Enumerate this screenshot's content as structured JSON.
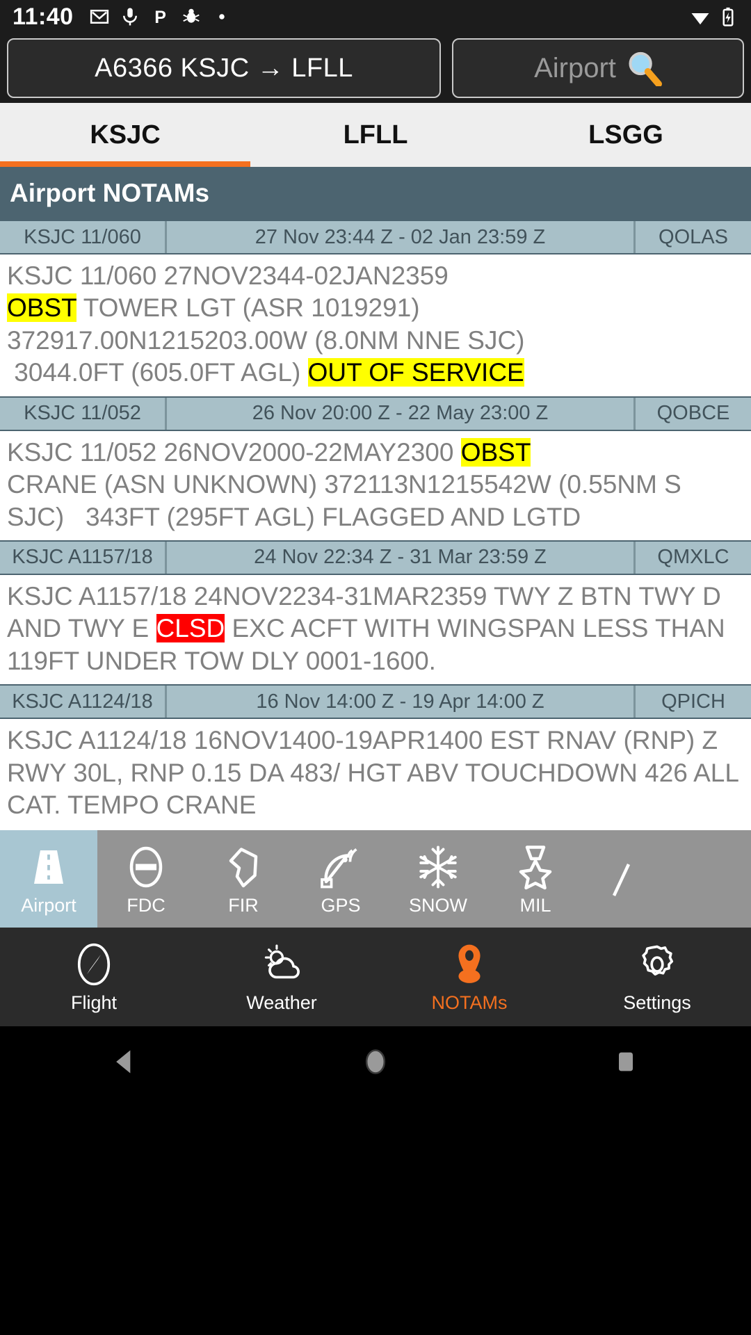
{
  "status_bar": {
    "time": "11:40",
    "icons": [
      "gmail-icon",
      "microphone-icon",
      "parking-icon",
      "bug-icon",
      "dot-icon"
    ],
    "right_icons": [
      "wifi-icon",
      "battery-charging-icon"
    ]
  },
  "topbar": {
    "route_label": "A6366 KSJC → LFLL",
    "search_placeholder": "Airport",
    "search_icon": "magnifier-icon"
  },
  "tabs": [
    {
      "label": "KSJC",
      "active": true
    },
    {
      "label": "LFLL",
      "active": false
    },
    {
      "label": "LSGG",
      "active": false
    }
  ],
  "section": {
    "title": "Airport NOTAMs"
  },
  "notams": [
    {
      "id": "KSJC 11/060",
      "period": "27 Nov 23:44 Z - 02 Jan 23:59 Z",
      "code": "QOLAS",
      "segments": [
        {
          "text": "KSJC 11/060 27NOV2344-02JAN2359\n",
          "highlight": "none"
        },
        {
          "text": "OBST",
          "highlight": "yellow"
        },
        {
          "text": " TOWER LGT (ASR 1019291)\n372917.00N1215203.00W (8.0NM NNE SJC)\n 3044.0FT (605.0FT AGL) ",
          "highlight": "none"
        },
        {
          "text": "OUT OF SERVICE",
          "highlight": "yellow"
        }
      ]
    },
    {
      "id": "KSJC 11/052",
      "period": "26 Nov 20:00 Z - 22 May 23:00 Z",
      "code": "QOBCE",
      "segments": [
        {
          "text": "KSJC 11/052 26NOV2000-22MAY2300 ",
          "highlight": "none"
        },
        {
          "text": "OBST",
          "highlight": "yellow"
        },
        {
          "text": "\nCRANE (ASN UNKNOWN) 372113N1215542W (0.55NM S SJC)   343FT (295FT AGL) FLAGGED AND LGTD",
          "highlight": "none"
        }
      ]
    },
    {
      "id": "KSJC A1157/18",
      "period": "24 Nov 22:34 Z - 31 Mar 23:59 Z",
      "code": "QMXLC",
      "segments": [
        {
          "text": "KSJC A1157/18 24NOV2234-31MAR2359 TWY Z BTN TWY D AND TWY E ",
          "highlight": "none"
        },
        {
          "text": "CLSD",
          "highlight": "red"
        },
        {
          "text": " EXC ACFT WITH WINGSPAN LESS THAN 119FT UNDER TOW DLY 0001-1600.",
          "highlight": "none"
        }
      ]
    },
    {
      "id": "KSJC A1124/18",
      "period": "16 Nov 14:00 Z - 19 Apr 14:00 Z",
      "code": "QPICH",
      "segments": [
        {
          "text": "KSJC A1124/18 16NOV1400-19APR1400 EST RNAV (RNP) Z RWY 30L, RNP 0.15 DA 483/ HGT ABV TOUCHDOWN 426 ALL CAT. TEMPO CRANE",
          "highlight": "none"
        }
      ]
    }
  ],
  "categories": [
    {
      "label": "Airport",
      "icon": "runway-icon",
      "active": true
    },
    {
      "label": "FDC",
      "icon": "no-entry-icon",
      "active": false
    },
    {
      "label": "FIR",
      "icon": "polygon-icon",
      "active": false
    },
    {
      "label": "GPS",
      "icon": "satellite-dish-icon",
      "active": false
    },
    {
      "label": "SNOW",
      "icon": "snowflake-icon",
      "active": false
    },
    {
      "label": "MIL",
      "icon": "medal-icon",
      "active": false
    }
  ],
  "bottom_nav": [
    {
      "label": "Flight",
      "icon": "compass-icon",
      "active": false
    },
    {
      "label": "Weather",
      "icon": "sun-cloud-icon",
      "active": false
    },
    {
      "label": "NOTAMs",
      "icon": "map-pin-icon",
      "active": true
    },
    {
      "label": "Settings",
      "icon": "gear-icon",
      "active": false
    }
  ],
  "android_nav": [
    {
      "name": "back-button",
      "icon": "triangle-left-icon"
    },
    {
      "name": "home-button",
      "icon": "circle-icon"
    },
    {
      "name": "recents-button",
      "icon": "square-icon"
    }
  ],
  "colors": {
    "accent": "#f4701f",
    "header_bg": "#4c6470",
    "meta_bg": "#a8c0c8",
    "highlight_yellow": "#ffff00",
    "highlight_red": "#ff0000"
  }
}
